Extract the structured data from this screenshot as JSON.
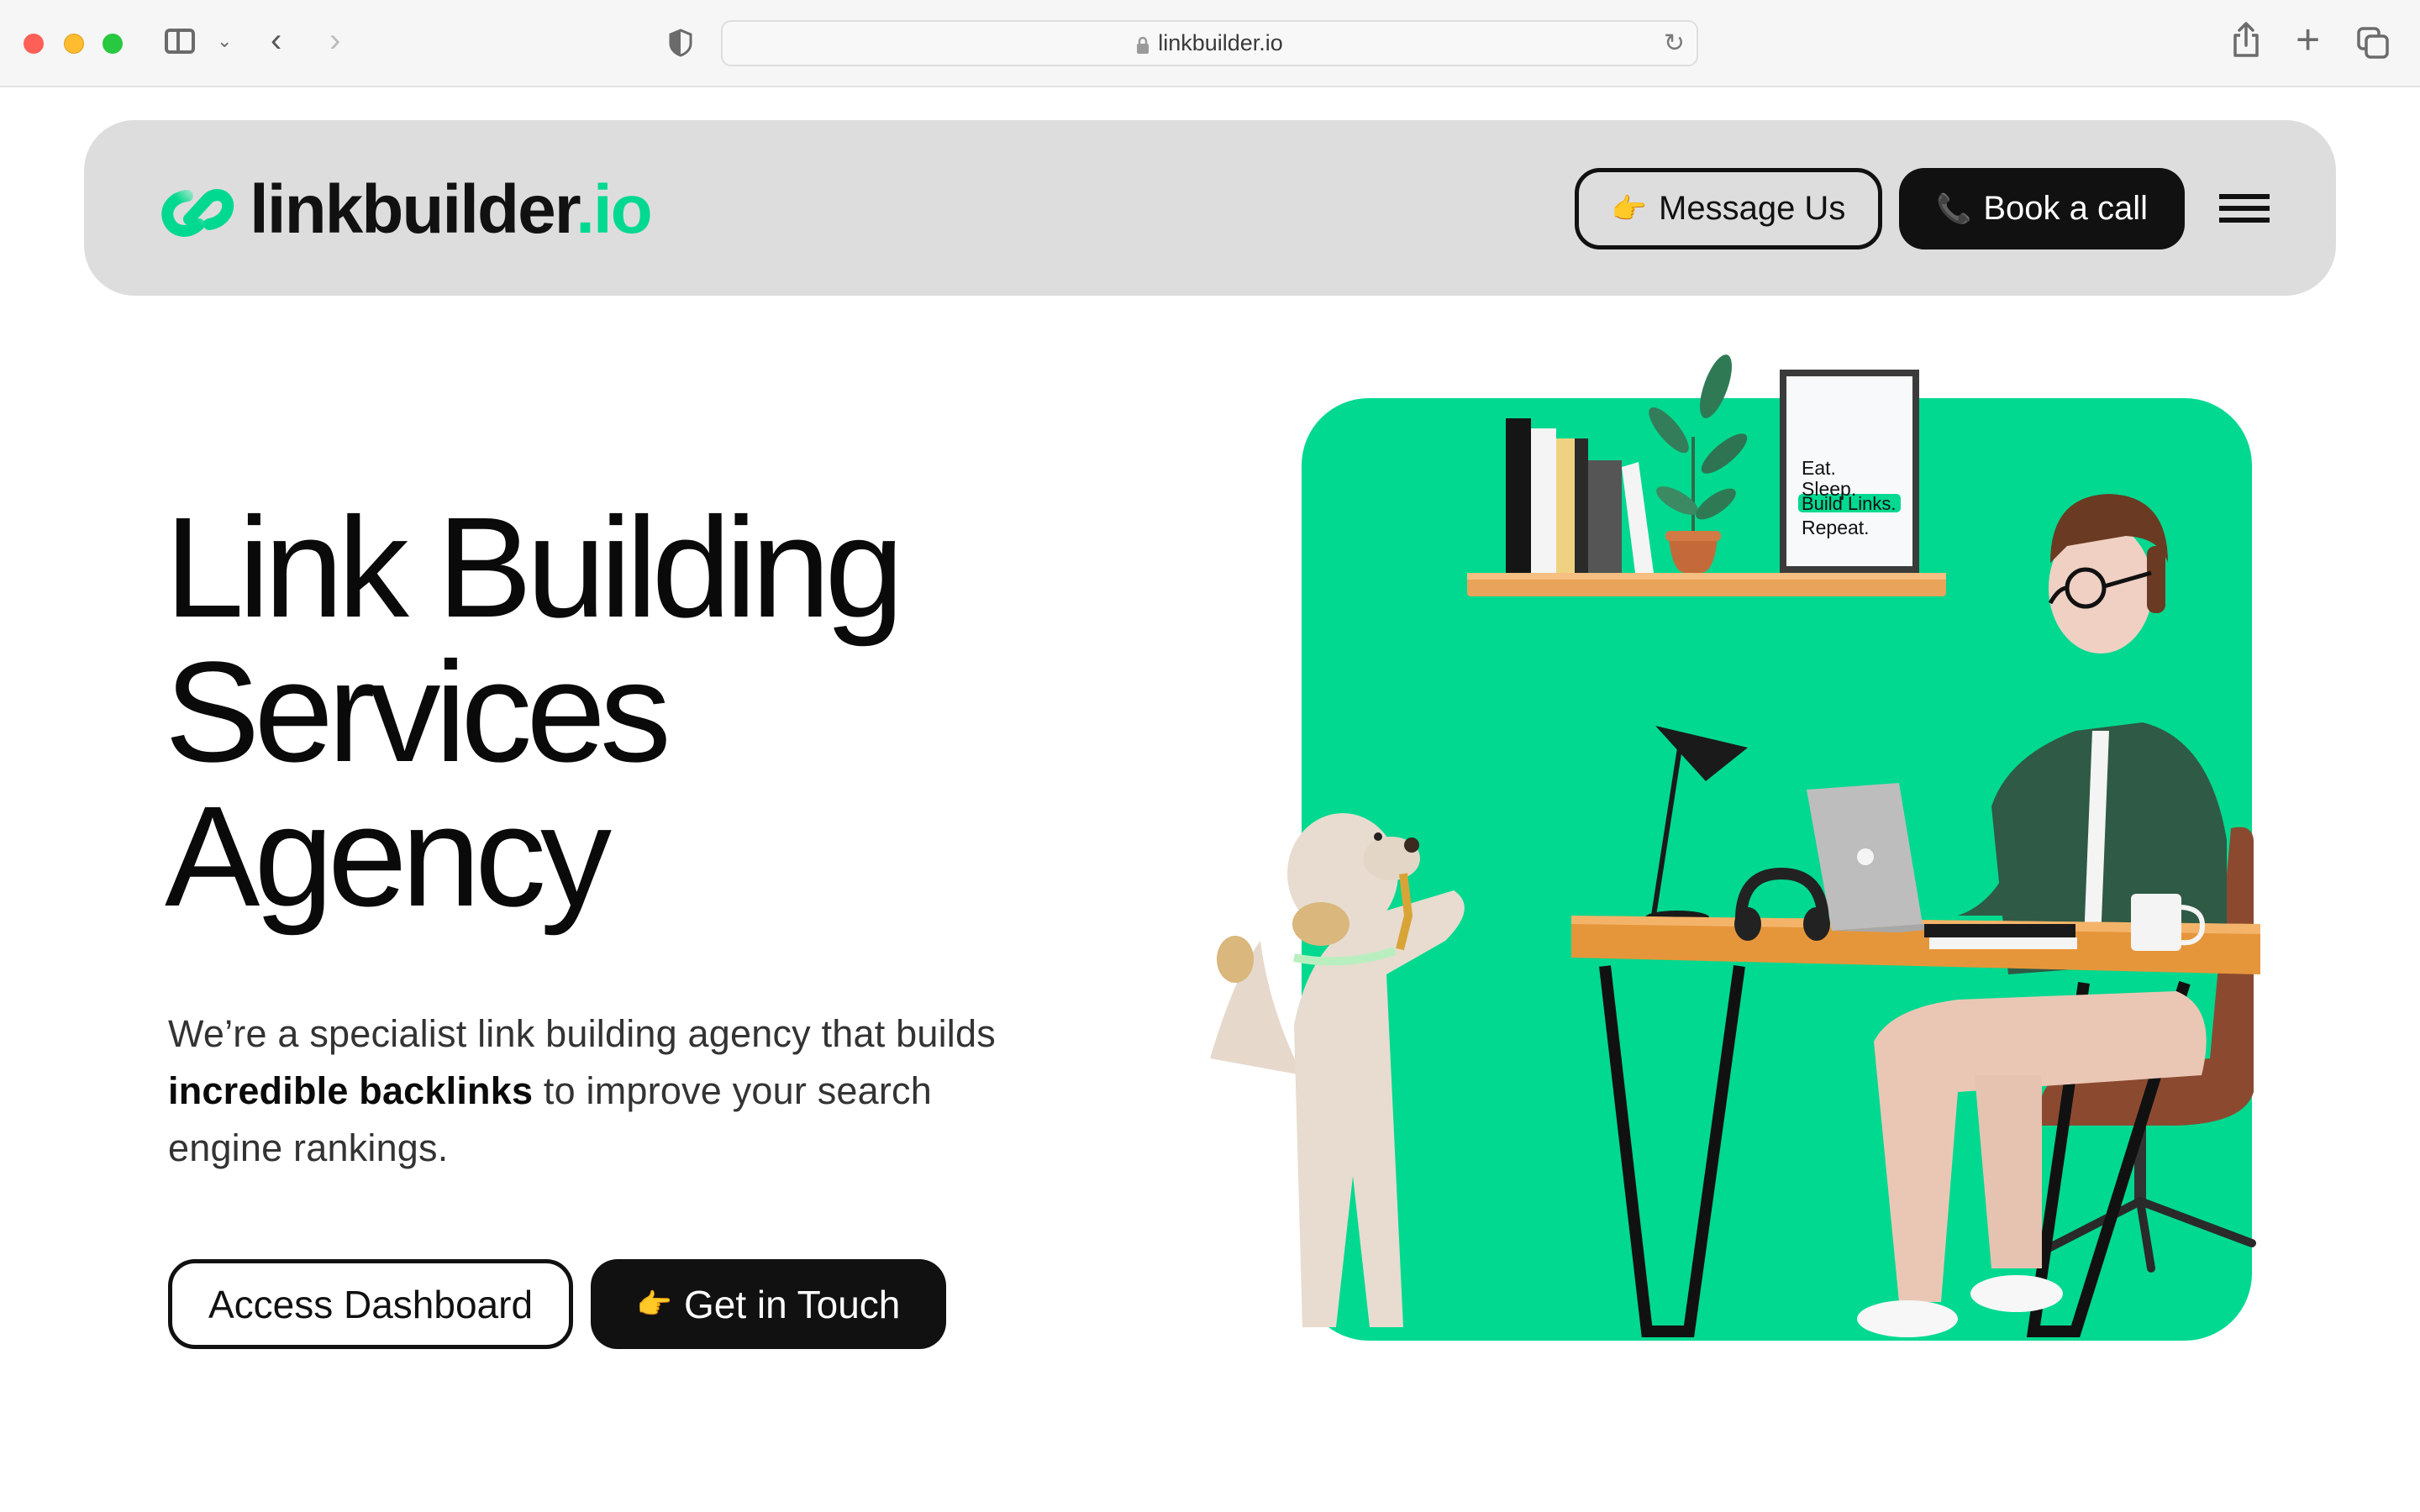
{
  "browser": {
    "url": "linkbuilder.io",
    "icons": [
      "sidebar-icon",
      "chevron-down-icon",
      "back-icon",
      "forward-icon",
      "shield-icon",
      "lock-icon",
      "reload-icon",
      "share-icon",
      "new-tab-icon",
      "tabs-overview-icon"
    ]
  },
  "header": {
    "logo_name": "linkbuilder",
    "logo_tld": ".io",
    "message_button": {
      "icon": "👉",
      "label": "Message Us"
    },
    "call_button": {
      "icon": "📞",
      "label": "Book a call"
    },
    "menu_icon": "hamburger-icon"
  },
  "hero": {
    "title_lines": [
      "Link Building",
      "Services",
      "Agency"
    ],
    "description": {
      "part1": "We’re a specialist link building agency that builds ",
      "bold": "incredible backlinks",
      "part2": " to improve your search engine rankings."
    },
    "dashboard_button": "Access Dashboard",
    "touch_button": {
      "icon": "👉",
      "label": "Get in Touch"
    }
  },
  "illustration": {
    "poster_lines": [
      "Eat.",
      "Sleep.",
      "Build Links.",
      "Repeat."
    ],
    "highlighted_line": "Build Links.",
    "description": "3D scene: man in glasses typing on laptop at desk, dog standing at desk, shelf with books, plant and poster",
    "accent_color": "#00d98f"
  },
  "colors": {
    "brand_green": "#00d98f",
    "header_bg": "#dddddd",
    "dark_button": "#111111"
  }
}
